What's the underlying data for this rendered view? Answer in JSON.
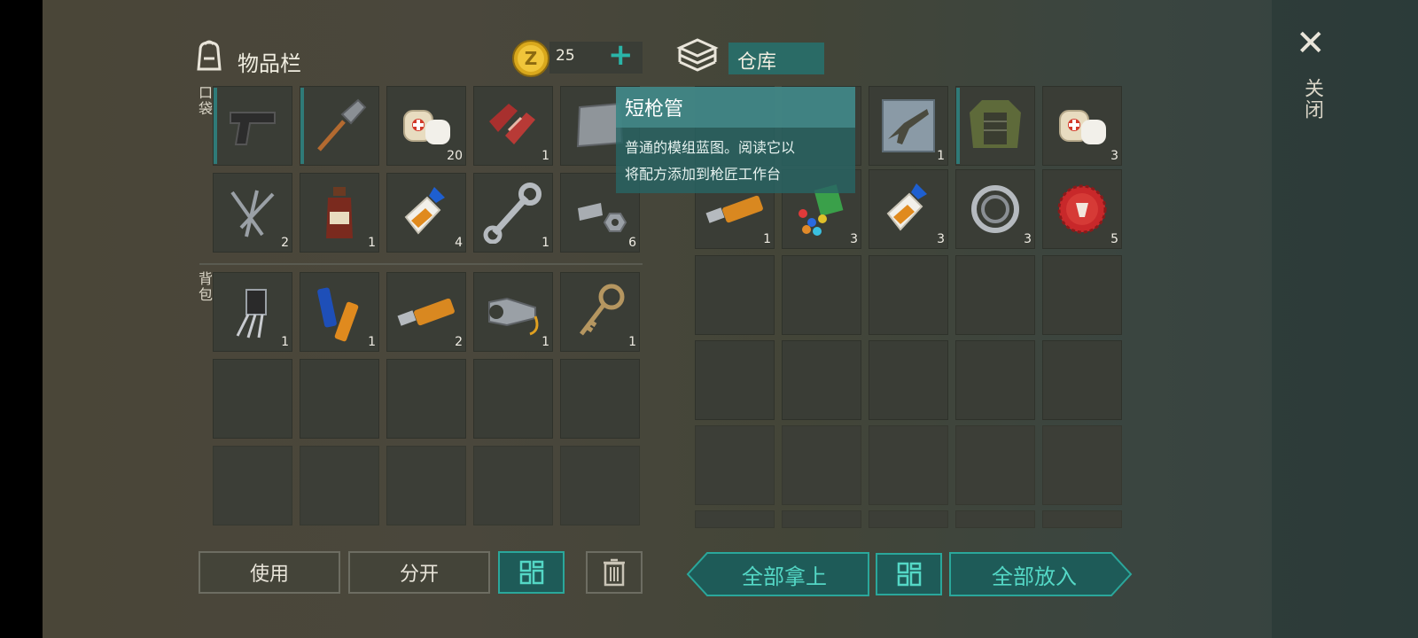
{
  "inventory": {
    "title": "物品栏",
    "coins": "25",
    "plus": "+",
    "pocket_label": "口袋",
    "backpack_label": "背包"
  },
  "storage": {
    "title": "仓库"
  },
  "close_label": "关闭",
  "close_x": "✕",
  "tooltip": {
    "title": "短枪管",
    "desc_line1": "普通的模组蓝图。阅读它以",
    "desc_line2": "将配方添加到枪匠工作台"
  },
  "pocket_items": [
    {
      "name": "pistol",
      "count": ""
    },
    {
      "name": "shovel",
      "count": ""
    },
    {
      "name": "bandage",
      "count": "20"
    },
    {
      "name": "raw-meat",
      "count": "1"
    },
    {
      "name": "metal-plate",
      "count": ""
    },
    {
      "name": "nails",
      "count": "2"
    },
    {
      "name": "bottle",
      "count": "1"
    },
    {
      "name": "glue",
      "count": "4"
    },
    {
      "name": "wrench",
      "count": "1"
    },
    {
      "name": "bolt-nut",
      "count": "6"
    }
  ],
  "backpack_items": [
    {
      "name": "transistor",
      "count": "1"
    },
    {
      "name": "batteries",
      "count": "1"
    },
    {
      "name": "usb-drive",
      "count": "2"
    },
    {
      "name": "flashlight",
      "count": "1"
    },
    {
      "name": "key",
      "count": "1"
    }
  ],
  "storage_items": [
    {
      "name": "hidden-item",
      "count": ""
    },
    {
      "name": "hidden-item-2",
      "count": ""
    },
    {
      "name": "rifle-blueprint",
      "count": "1"
    },
    {
      "name": "armored-jacket",
      "count": ""
    },
    {
      "name": "bandage",
      "count": "3"
    },
    {
      "name": "usb-drive",
      "count": "1"
    },
    {
      "name": "plastic-scraps",
      "count": "3"
    },
    {
      "name": "glue",
      "count": "3"
    },
    {
      "name": "bearing",
      "count": "3"
    },
    {
      "name": "bottle-cap",
      "count": "5"
    }
  ],
  "buttons": {
    "use": "使用",
    "split": "分开",
    "take_all": "全部拿上",
    "put_all": "全部放入"
  },
  "colors": {
    "accent": "#2aa79b",
    "accent_text": "#54d8c6",
    "coin": "#e0b020"
  }
}
